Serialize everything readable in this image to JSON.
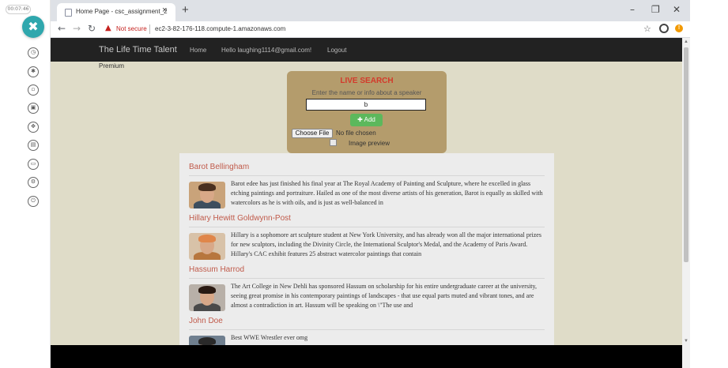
{
  "recorder": {
    "timer": "00:07:46",
    "close_glyph": "✖",
    "tools": [
      {
        "icon": "timer-icon",
        "glyph": "◷"
      },
      {
        "icon": "bug-icon",
        "glyph": "✱"
      },
      {
        "icon": "video-icon",
        "glyph": "▫"
      },
      {
        "icon": "screen-icon",
        "glyph": "▣"
      },
      {
        "icon": "pointer-icon",
        "glyph": "✥"
      },
      {
        "icon": "keyboard-icon",
        "glyph": "▤"
      },
      {
        "icon": "folder-icon",
        "glyph": "▭"
      },
      {
        "icon": "settings-icon",
        "glyph": "⚙"
      },
      {
        "icon": "power-icon",
        "glyph": "⏻"
      }
    ]
  },
  "browser": {
    "tab_title": "Home Page - csc_assignment_2",
    "tab_close": "×",
    "new_tab": "+",
    "window_controls": {
      "minimize": "–",
      "maximize": "❐",
      "close": "✕"
    },
    "nav": {
      "back": "←",
      "forward": "→",
      "reload": "↻"
    },
    "security_icon": "▲",
    "security_label": "Not secure",
    "url": "ec2-3-82-176-118.compute-1.amazonaws.com",
    "star": "☆",
    "alert": "!"
  },
  "site": {
    "brand": "The Life Time Talent",
    "nav_home": "Home",
    "nav_user": "Hello laughing1114@gmail.com!",
    "nav_logout": "Logout",
    "premium": "Premium",
    "search": {
      "title": "LIVE SEARCH",
      "hint": "Enter the name or info about a speaker",
      "value": "b",
      "add_label": "✚ Add",
      "choose_file": "Choose File",
      "no_file": "No file chosen",
      "image_preview": "Image preview"
    },
    "results": [
      {
        "name": "Barot Bellingham",
        "description": "Barot edee has just finished his final year at The Royal Academy of Painting and Sculpture, where he excelled in glass etching paintings and portraiture. Hailed as one of the most diverse artists of his generation, Barot is equally as skilled with watercolors as he is with oils, and is just as well-balanced in",
        "colors": {
          "bg": "#c9a37a",
          "hair": "#4a3020",
          "body": "#3d4e5e"
        }
      },
      {
        "name": "Hillary Hewitt Goldwynn-Post",
        "description": "Hillary is a sophomore art sculpture student at New York University, and has already won all the major international prizes for new sculptors, including the Divinity Circle, the International Sculptor's Medal, and the Academy of Paris Award. Hillary's CAC exhibit features 25 abstract watercolor paintings that contain",
        "colors": {
          "bg": "#d8c2a8",
          "hair": "#e0864a",
          "body": "#b7763e"
        }
      },
      {
        "name": "Hassum Harrod",
        "description": "The Art College in New Dehli has sponsored Hassum on scholarship for his entire undergraduate career at the university, seeing great promise in his contemporary paintings of landscapes - that use equal parts muted and vibrant tones, and are almost a contradiction in art. Hassum will be speaking on \\\"The use and",
        "colors": {
          "bg": "#b8b0a8",
          "hair": "#2a1a12",
          "body": "#4a4a4a"
        }
      },
      {
        "name": "John Doe",
        "description": "Best WWE Wrestler ever omg",
        "colors": {
          "bg": "#6f7f8f",
          "hair": "#2a2a2a",
          "body": "#2f3d4b"
        }
      }
    ],
    "scroll_up": "▲",
    "scroll_down": "▼"
  }
}
